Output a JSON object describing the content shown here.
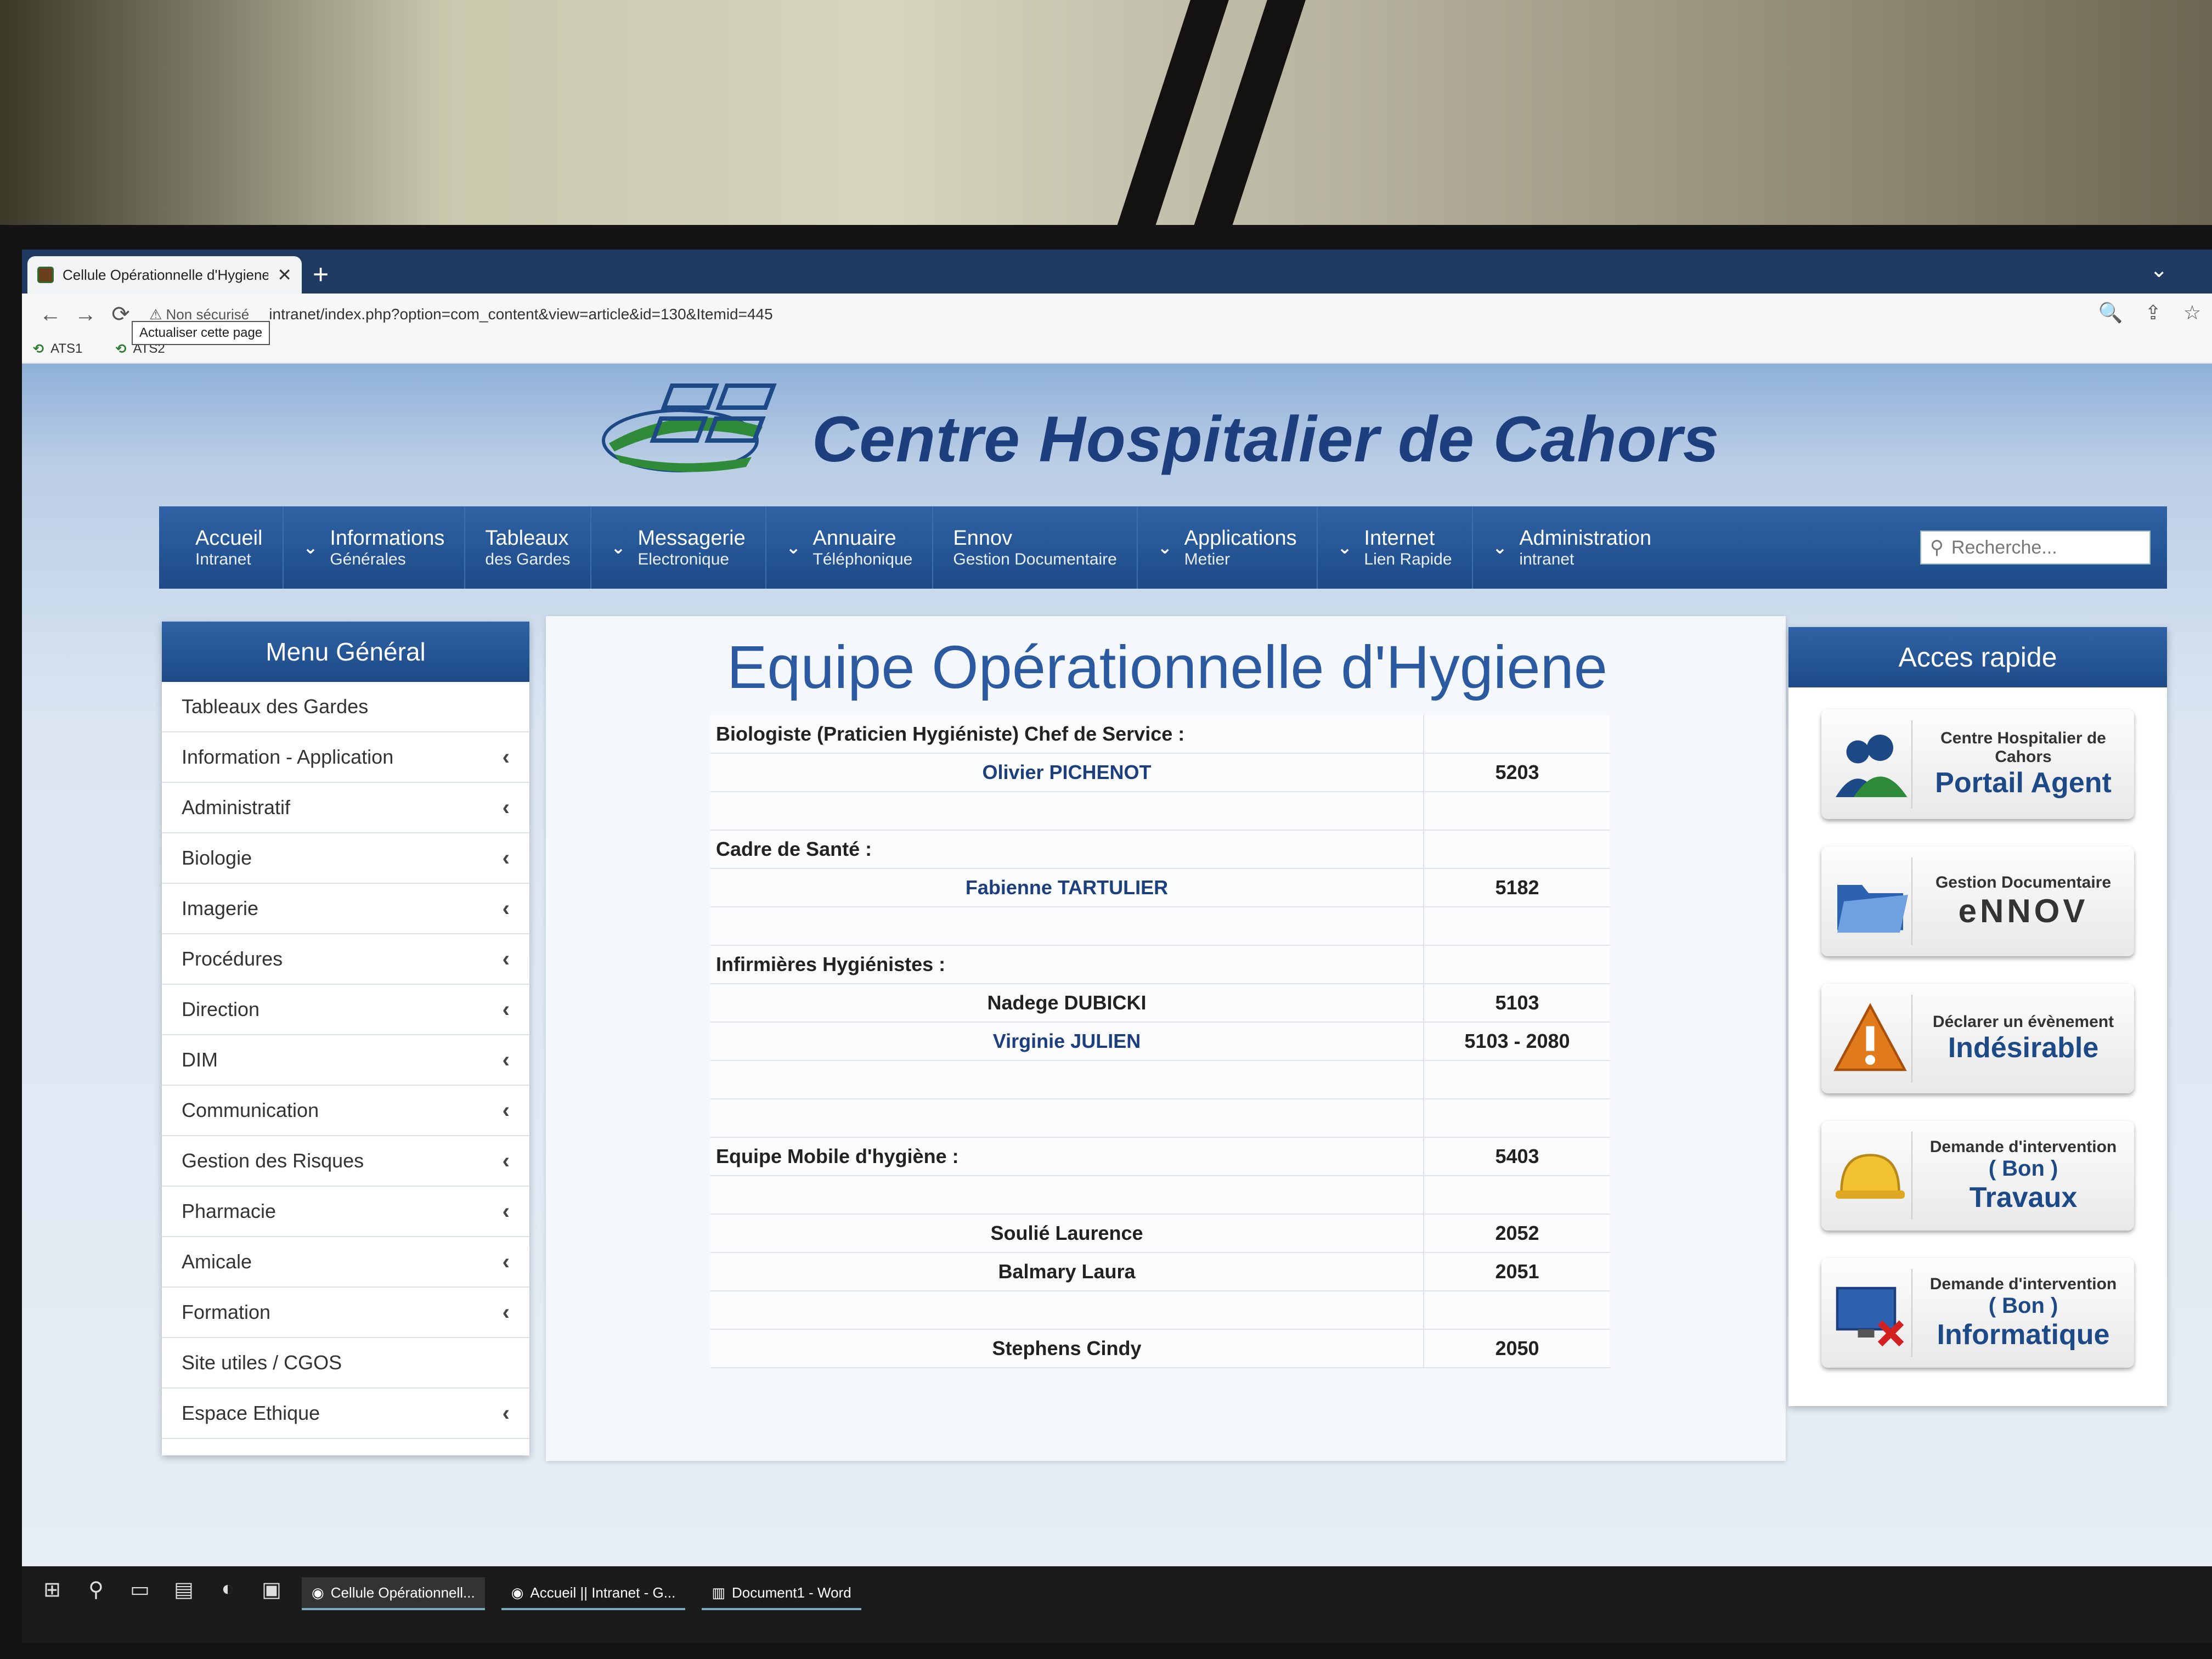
{
  "browser": {
    "tab_title": "Cellule Opérationnelle d'Hygiene",
    "tab_close": "✕",
    "new_tab": "+",
    "tab_menu": "⌄",
    "back": "←",
    "forward": "→",
    "reload": "⟳",
    "security": "⚠ Non sécurisé",
    "url": "intranet/index.php?option=com_content&view=article&id=130&Itemid=445",
    "tooltip": "Actualiser cette page",
    "zoom_icon": "🔍",
    "share_icon": "⇪",
    "star_icon": "☆",
    "bookmarks": [
      {
        "label": "ATS1"
      },
      {
        "label": "ATS2"
      }
    ]
  },
  "site": {
    "title": "Centre Hospitalier de Cahors"
  },
  "nav": {
    "items": [
      {
        "l1": "Accueil",
        "l2": "Intranet",
        "has_chev": false
      },
      {
        "l1": "Informations",
        "l2": "Générales",
        "has_chev": true
      },
      {
        "l1": "Tableaux",
        "l2": "des Gardes",
        "has_chev": false
      },
      {
        "l1": "Messagerie",
        "l2": "Electronique",
        "has_chev": true
      },
      {
        "l1": "Annuaire",
        "l2": "Téléphonique",
        "has_chev": true
      },
      {
        "l1": "Ennov",
        "l2": "Gestion Documentaire",
        "has_chev": false
      },
      {
        "l1": "Applications",
        "l2": "Metier",
        "has_chev": true
      },
      {
        "l1": "Internet",
        "l2": "Lien Rapide",
        "has_chev": true
      },
      {
        "l1": "Administration",
        "l2": "intranet",
        "has_chev": true
      }
    ],
    "search_placeholder": "Recherche..."
  },
  "sidebar": {
    "title": "Menu Général",
    "items": [
      {
        "label": "Tableaux des Gardes",
        "chev": false
      },
      {
        "label": "Information - Application",
        "chev": true
      },
      {
        "label": "Administratif",
        "chev": true
      },
      {
        "label": "Biologie",
        "chev": true
      },
      {
        "label": "Imagerie",
        "chev": true
      },
      {
        "label": "Procédures",
        "chev": true
      },
      {
        "label": "Direction",
        "chev": true
      },
      {
        "label": "DIM",
        "chev": true
      },
      {
        "label": "Communication",
        "chev": true
      },
      {
        "label": "Gestion des Risques",
        "chev": true
      },
      {
        "label": "Pharmacie",
        "chev": true
      },
      {
        "label": "Amicale",
        "chev": true
      },
      {
        "label": "Formation",
        "chev": true
      },
      {
        "label": "Site utiles / CGOS",
        "chev": false
      },
      {
        "label": "Espace Ethique",
        "chev": true
      }
    ]
  },
  "content": {
    "title": "Equipe Opérationnelle d'Hygiene",
    "rows": [
      {
        "type": "section",
        "text": "Biologiste (Praticien Hygiéniste) Chef de Service :",
        "num": ""
      },
      {
        "type": "name",
        "text": "Olivier PICHENOT",
        "num": "5203",
        "dark": false
      },
      {
        "type": "blank",
        "text": "",
        "num": ""
      },
      {
        "type": "section",
        "text": "Cadre de Santé :",
        "num": ""
      },
      {
        "type": "name",
        "text": "Fabienne TARTULIER",
        "num": "5182",
        "dark": false
      },
      {
        "type": "blank",
        "text": "",
        "num": ""
      },
      {
        "type": "section",
        "text": "Infirmières Hygiénistes :",
        "num": ""
      },
      {
        "type": "name",
        "text": "Nadege DUBICKI",
        "num": "5103",
        "dark": true
      },
      {
        "type": "name",
        "text": "Virginie JULIEN",
        "num": "5103 - 2080",
        "dark": false
      },
      {
        "type": "blank",
        "text": "",
        "num": ""
      },
      {
        "type": "blank",
        "text": "",
        "num": ""
      },
      {
        "type": "section",
        "text": "Equipe Mobile d'hygiène :",
        "num": "5403"
      },
      {
        "type": "blank",
        "text": "",
        "num": ""
      },
      {
        "type": "name",
        "text": "Soulié Laurence",
        "num": "2052",
        "dark": true
      },
      {
        "type": "name",
        "text": "Balmary Laura",
        "num": "2051",
        "dark": true
      },
      {
        "type": "blank",
        "text": "",
        "num": ""
      },
      {
        "type": "name",
        "text": "Stephens Cindy",
        "num": "2050",
        "dark": true
      }
    ]
  },
  "quick": {
    "title": "Acces rapide",
    "cards": [
      {
        "small": "Centre Hospitalier de Cahors",
        "big": "Portail Agent",
        "icon": "users-icon"
      },
      {
        "small": "Gestion Documentaire",
        "big": "eNNOV",
        "icon": "folder-icon"
      },
      {
        "small": "Déclarer un évènement",
        "big": "Indésirable",
        "icon": "warning-icon"
      },
      {
        "small": "Demande d'intervention",
        "mid": "( Bon )",
        "big": "Travaux",
        "icon": "hardhat-icon"
      },
      {
        "small": "Demande d'intervention",
        "mid": "( Bon )",
        "big": "Informatique",
        "icon": "computer-error-icon"
      }
    ]
  },
  "taskbar": {
    "apps": [
      {
        "label": "Cellule Opérationnell...",
        "active": true
      },
      {
        "label": "Accueil || Intranet - G...",
        "active": false
      },
      {
        "label": "Document1 - Word",
        "active": false
      }
    ]
  },
  "colors": {
    "brand_blue": "#1d4a87",
    "title_blue": "#2b5aa0",
    "logo_green": "#2f8a3a"
  }
}
